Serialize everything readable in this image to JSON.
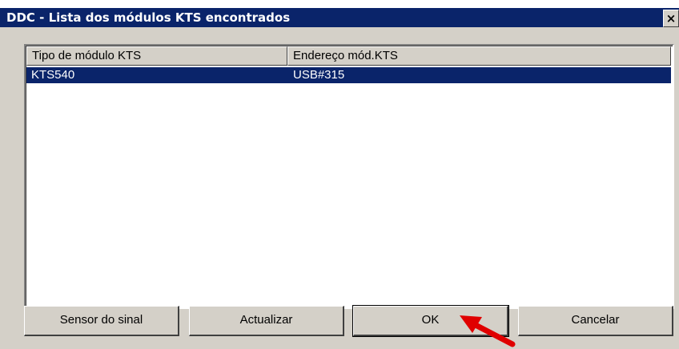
{
  "window": {
    "title": "DDC - Lista dos módulos KTS encontrados",
    "close_glyph": "×"
  },
  "list": {
    "columns": [
      "Tipo de módulo KTS",
      "Endereço mód.KTS"
    ],
    "rows": [
      {
        "tipo": "KTS540",
        "endereco": "USB#315",
        "selected": true
      }
    ]
  },
  "buttons": {
    "sensor": "Sensor do sinal",
    "actualizar": "Actualizar",
    "ok": "OK",
    "cancelar": "Cancelar"
  },
  "annotation": {
    "arrow_color": "#e00000",
    "target": "OK"
  }
}
